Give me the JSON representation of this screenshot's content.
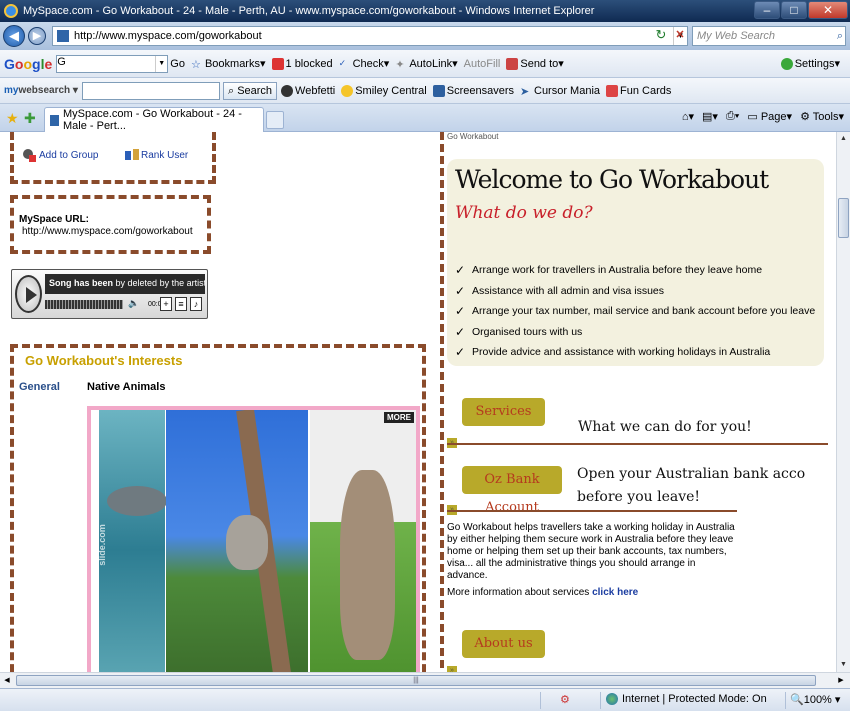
{
  "window": {
    "title": "MySpace.com - Go Workabout - 24 - Male - Perth, AU - www.myspace.com/goworkabout - Windows Internet Explorer"
  },
  "address": {
    "url": "http://www.myspace.com/goworkabout",
    "search_placeholder": "My Web Search"
  },
  "google_toolbar": {
    "logo": [
      "G",
      "o",
      "o",
      "g",
      "l",
      "e"
    ],
    "select_value": "G",
    "go_label": "Go",
    "bookmarks_label": "Bookmarks",
    "blocked_label": "1 blocked",
    "check_label": "Check",
    "autolink_label": "AutoLink",
    "autofill_label": "AutoFill",
    "sendto_label": "Send to",
    "settings_label": "Settings"
  },
  "myweb_toolbar": {
    "logo_prefix": "my",
    "logo_suffix": "websearch",
    "search_label": "Search",
    "links": [
      "Webfetti",
      "Smiley Central",
      "Screensavers",
      "Cursor Mania",
      "Fun Cards"
    ]
  },
  "tab": {
    "title": "MySpace.com - Go Workabout - 24 - Male - Pert..."
  },
  "command_bar": {
    "page_label": "Page",
    "tools_label": "Tools"
  },
  "profile": {
    "add_to_group": "Add to Group",
    "rank_user": "Rank User",
    "url_label": "MySpace URL:",
    "url_value": "http://www.myspace.com/goworkabout",
    "player": {
      "song_title": "Song has been",
      "song_note": "by deleted by the artist",
      "time": "00:00"
    },
    "interests_title": "Go Workabout's Interests",
    "interest_category": "General",
    "interest_value": "Native Animals",
    "slideshow_more": "MORE",
    "slideshow_watermark": "slide.com"
  },
  "right": {
    "top_cut_text": "Go Workabout",
    "welcome_title": "Welcome to Go Workabout",
    "welcome_sub": "What do we do?",
    "bullets": [
      "Arrange work for travellers in Australia before they leave home",
      "Assistance with all admin and visa issues",
      "Arrange your tax number, mail service and bank account before you leave",
      "Organised tours with us",
      "Provide advice and assistance with working holidays in Australia"
    ],
    "services_badge": "Services",
    "services_tagline": "What we can do for you!",
    "bank_badge": "Oz Bank Account",
    "bank_tagline_1": "Open your Australian bank acco",
    "bank_tagline_2": "before you leave!",
    "body_text": "Go Workabout helps travellers take a working holiday in Australia by either helping them secure work in Australia before they leave home or helping them set up their bank accounts, tax numbers, visa... all the administrative things you should arrange in advance.",
    "more_info_text": "More information about services",
    "more_info_link": "click here",
    "about_badge": "About us"
  },
  "status": {
    "zone": "Internet | Protected Mode: On",
    "zoom": "100%"
  },
  "colors": {
    "border_brown": "#8a4b2b",
    "olive_badge": "#b8a92a",
    "title_red": "#c8202a",
    "interest_gold": "#c8a000"
  }
}
